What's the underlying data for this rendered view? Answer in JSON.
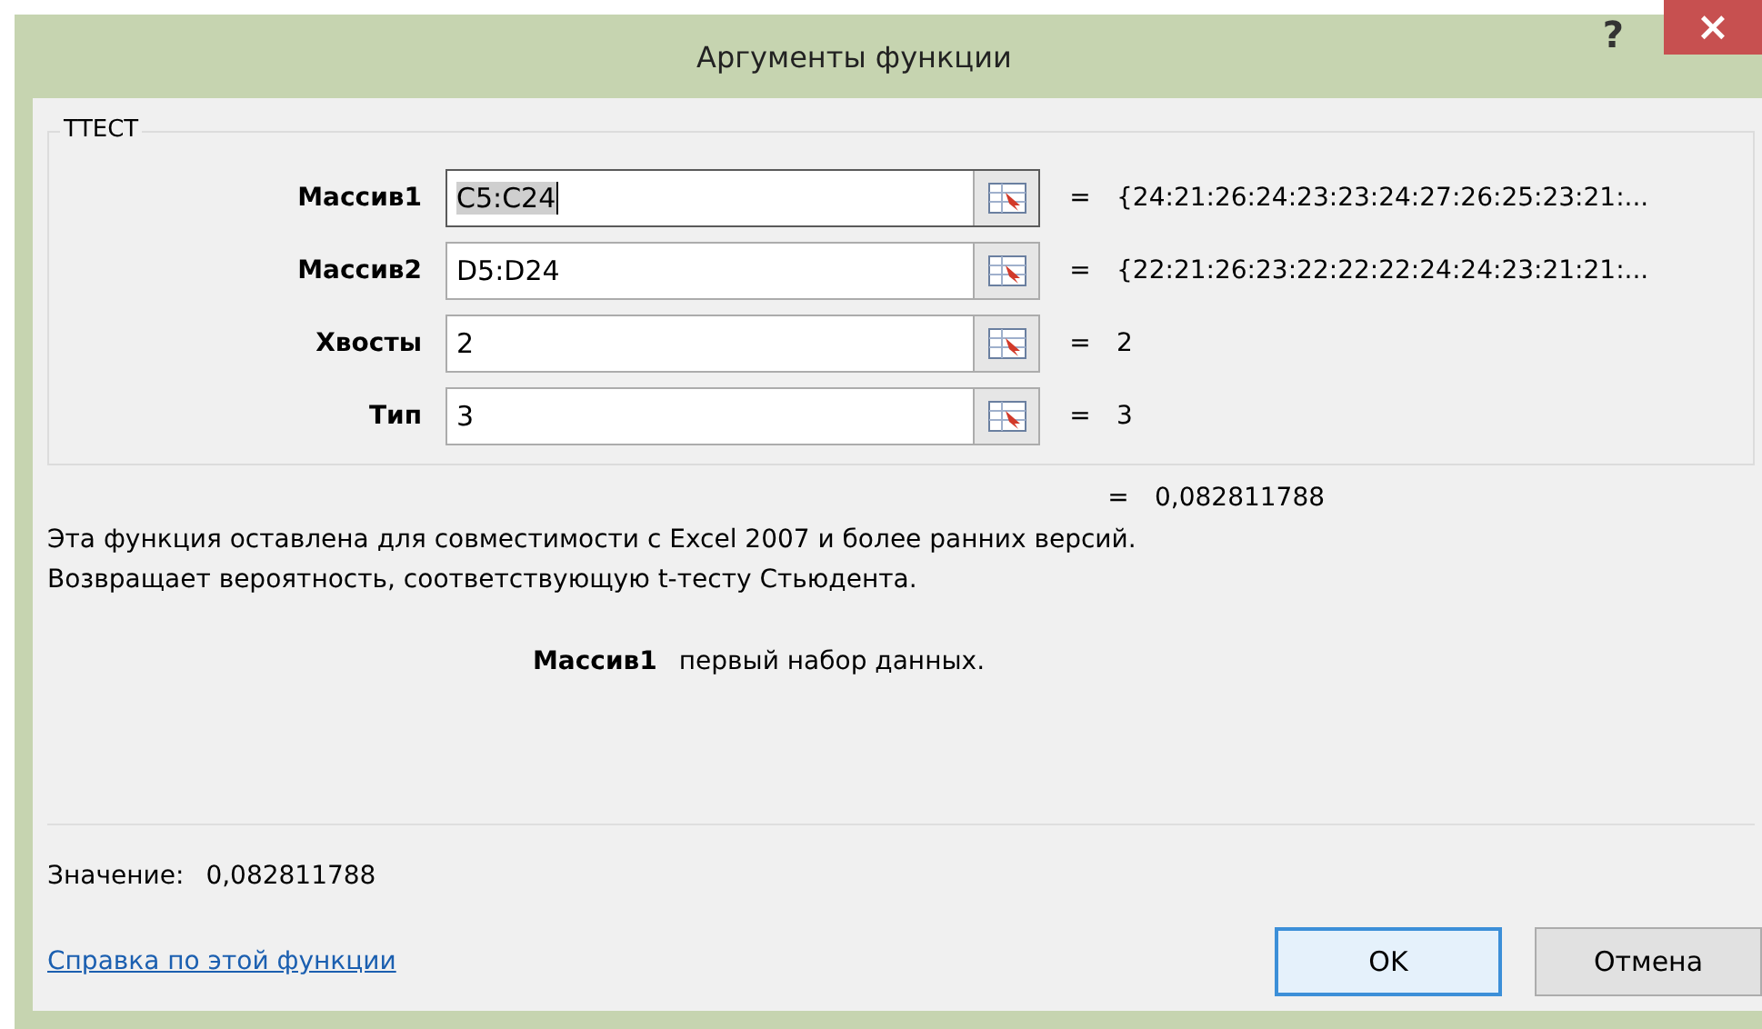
{
  "window": {
    "title": "Аргументы функции",
    "help_glyph": "?",
    "close_glyph": "×"
  },
  "group": {
    "title": "ТТЕСТ",
    "arguments": [
      {
        "label": "Массив1",
        "value": "C5:C24",
        "focused": true,
        "result": "{24:21:26:24:23:23:24:27:26:25:23:21:..."
      },
      {
        "label": "Массив2",
        "value": "D5:D24",
        "focused": false,
        "result": "{22:21:26:23:22:22:22:24:24:23:21:21:..."
      },
      {
        "label": "Хвосты",
        "value": "2",
        "focused": false,
        "result": "2"
      },
      {
        "label": "Тип",
        "value": "3",
        "focused": false,
        "result": "3"
      }
    ]
  },
  "equals": "=",
  "formula_result": "0,082811788",
  "description": [
    "Эта функция оставлена для совместимости с Excel 2007 и более ранних версий.",
    "Возвращает вероятность, соответствующую t-тесту Стьюдента."
  ],
  "argument_help": {
    "name": "Массив1",
    "text": "первый набор данных."
  },
  "value": {
    "label": "Значение:",
    "text": "0,082811788"
  },
  "help_link": "Справка по этой функции",
  "buttons": [
    {
      "label": "OK",
      "default": true
    },
    {
      "label": "Отмена",
      "default": false
    }
  ]
}
